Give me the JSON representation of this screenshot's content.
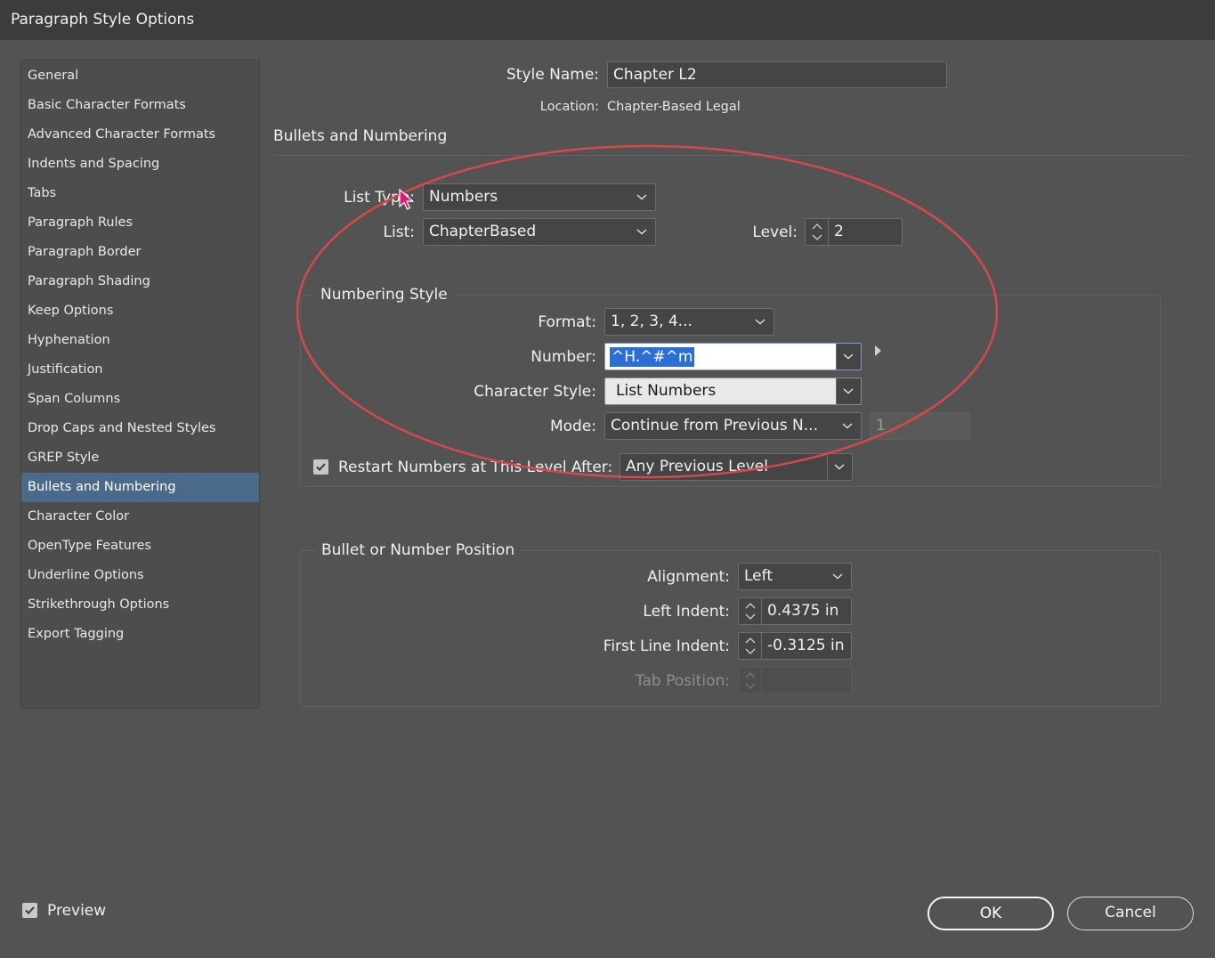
{
  "window": {
    "title": "Paragraph Style Options"
  },
  "sidebar": {
    "items": [
      {
        "label": "General",
        "active": false
      },
      {
        "label": "Basic Character Formats",
        "active": false
      },
      {
        "label": "Advanced Character Formats",
        "active": false
      },
      {
        "label": "Indents and Spacing",
        "active": false
      },
      {
        "label": "Tabs",
        "active": false
      },
      {
        "label": "Paragraph Rules",
        "active": false
      },
      {
        "label": "Paragraph Border",
        "active": false
      },
      {
        "label": "Paragraph Shading",
        "active": false
      },
      {
        "label": "Keep Options",
        "active": false
      },
      {
        "label": "Hyphenation",
        "active": false
      },
      {
        "label": "Justification",
        "active": false
      },
      {
        "label": "Span Columns",
        "active": false
      },
      {
        "label": "Drop Caps and Nested Styles",
        "active": false
      },
      {
        "label": "GREP Style",
        "active": false
      },
      {
        "label": "Bullets and Numbering",
        "active": true
      },
      {
        "label": "Character Color",
        "active": false
      },
      {
        "label": "OpenType Features",
        "active": false
      },
      {
        "label": "Underline Options",
        "active": false
      },
      {
        "label": "Strikethrough Options",
        "active": false
      },
      {
        "label": "Export Tagging",
        "active": false
      }
    ]
  },
  "header": {
    "style_name_label": "Style Name:",
    "style_name_value": "Chapter L2",
    "location_label": "Location:",
    "location_value": "Chapter-Based Legal"
  },
  "section": {
    "title": "Bullets and Numbering"
  },
  "list": {
    "list_type_label": "List Type:",
    "list_type_value": "Numbers",
    "list_label": "List:",
    "list_value": "ChapterBased",
    "level_label": "Level:",
    "level_value": "2"
  },
  "numbering_style": {
    "title": "Numbering Style",
    "format_label": "Format:",
    "format_value": "1, 2, 3, 4...",
    "number_label": "Number:",
    "number_value": "^H.^#^m",
    "char_style_label": "Character Style:",
    "char_style_value": "List Numbers",
    "mode_label": "Mode:",
    "mode_value": "Continue from Previous N...",
    "mode_start_value": "1",
    "restart_label": "Restart Numbers at This Level After:",
    "restart_checked": true,
    "restart_value": "Any Previous Level"
  },
  "position": {
    "title": "Bullet or Number Position",
    "alignment_label": "Alignment:",
    "alignment_value": "Left",
    "left_indent_label": "Left Indent:",
    "left_indent_value": "0.4375 in",
    "first_line_label": "First Line Indent:",
    "first_line_value": "-0.3125 in",
    "tab_position_label": "Tab Position:"
  },
  "footer": {
    "preview_label": "Preview",
    "preview_checked": true,
    "ok_label": "OK",
    "cancel_label": "Cancel"
  },
  "colors": {
    "background": "#535353",
    "titlebar": "#3c3c3c",
    "sidebar_active": "#4b6a89",
    "selection": "#2b6fd6",
    "annotation_ellipse": "#d94848",
    "cursor": "#e0167a"
  }
}
